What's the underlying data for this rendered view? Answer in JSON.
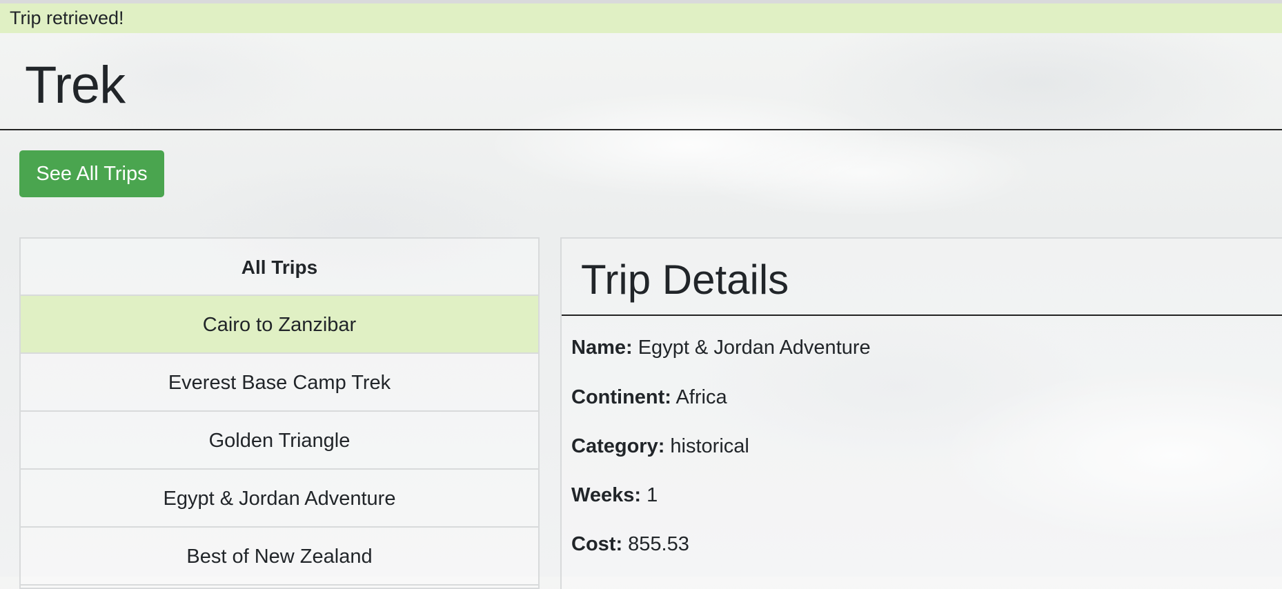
{
  "flash": {
    "message": "Trip retrieved!"
  },
  "header": {
    "title": "Trek"
  },
  "actions": {
    "see_all_label": "See All Trips"
  },
  "trips": {
    "heading": "All Trips",
    "items": [
      {
        "label": "Cairo to Zanzibar",
        "selected": true
      },
      {
        "label": "Everest Base Camp Trek",
        "selected": false
      },
      {
        "label": "Golden Triangle",
        "selected": false
      },
      {
        "label": "Egypt & Jordan Adventure",
        "selected": false
      },
      {
        "label": "Best of New Zealand",
        "selected": false
      }
    ]
  },
  "details": {
    "heading": "Trip Details",
    "fields": [
      {
        "label": "Name:",
        "value": "Egypt & Jordan Adventure"
      },
      {
        "label": "Continent:",
        "value": "Africa"
      },
      {
        "label": "Category:",
        "value": "historical"
      },
      {
        "label": "Weeks:",
        "value": "1"
      },
      {
        "label": "Cost:",
        "value": "855.53"
      }
    ]
  },
  "colors": {
    "flash_bg": "#e0f0c4",
    "button_bg": "#4aa54f",
    "active_item_bg": "#e0f0c4"
  }
}
